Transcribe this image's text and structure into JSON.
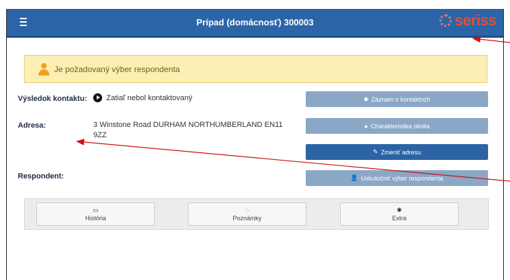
{
  "header": {
    "title": "Prípad (domácnosť) 300003",
    "logo_text": "seriss",
    "menu_icon": "hamburger-menu-icon",
    "background": "#2b65a8"
  },
  "alert": {
    "text": "Je požadovaný výber respondenta",
    "icon": "user-icon",
    "background": "#fbefb4"
  },
  "fields": {
    "contact_result_label": "Výsledok kontaktu:",
    "contact_result_value": "Zatiaľ nebol kontaktovaný",
    "address_label": "Adresa:",
    "address_line1": "3 Winstone Road DURHAM NORTHUMBERLAND EN11",
    "address_line2": "9ZZ",
    "respondent_label": "Respondent:"
  },
  "actions": {
    "contact_record": {
      "label": "Záznam o kontaktoch",
      "icon": "◆"
    },
    "neighborhood": {
      "label": "Charakteristika okolia",
      "icon": "●"
    },
    "change_address": {
      "label": "Zmeniť adresu",
      "icon": "✎"
    },
    "select_respondent": {
      "label": "Uskutočniť výber respondenta",
      "icon": "👤"
    }
  },
  "tabs": [
    {
      "label": "História",
      "icon": "▭"
    },
    {
      "label": "Poznámky",
      "icon": "◌"
    },
    {
      "label": "Extra",
      "icon": "✱"
    }
  ],
  "colors": {
    "accent": "#2b63a5",
    "muted_button": "#8ba7c6",
    "arrow": "#cc1111",
    "logo": "#e24e3b"
  }
}
